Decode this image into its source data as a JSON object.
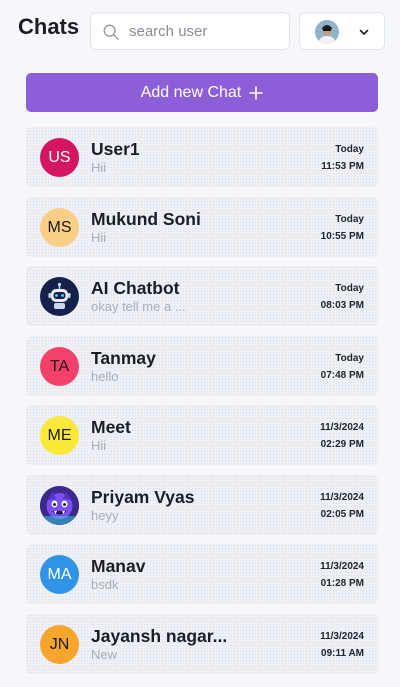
{
  "header": {
    "title": "Chats",
    "search_placeholder": "search user",
    "search_value": ""
  },
  "add_button": {
    "label": "Add new Chat"
  },
  "chats": [
    {
      "initials": "US",
      "name": "User1",
      "message": "Hii",
      "date": "Today",
      "time": "11:53 PM",
      "avatar_color": "#d4165e",
      "avatar_text": "light"
    },
    {
      "initials": "MS",
      "name": "Mukund Soni",
      "message": "Hii",
      "date": "Today",
      "time": "10:55 PM",
      "avatar_color": "#f9cf85",
      "avatar_text": "dark"
    },
    {
      "initials": "",
      "name": "AI Chatbot",
      "message": "okay tell me a ...",
      "date": "Today",
      "time": "08:03 PM",
      "avatar_color": "#13214b",
      "avatar_text": "light",
      "icon": "robot-icon"
    },
    {
      "initials": "TA",
      "name": "Tanmay",
      "message": "hello",
      "date": "Today",
      "time": "07:48 PM",
      "avatar_color": "#f4416c",
      "avatar_text": "dark"
    },
    {
      "initials": "ME",
      "name": "Meet",
      "message": "Hii",
      "date": "11/3/2024",
      "time": "02:29 PM",
      "avatar_color": "#fbe93a",
      "avatar_text": "dark"
    },
    {
      "initials": "",
      "name": "Priyam Vyas",
      "message": "heyy",
      "date": "11/3/2024",
      "time": "02:05 PM",
      "avatar_color": "#5b3fc7",
      "avatar_text": "light",
      "icon": "character-avatar-icon"
    },
    {
      "initials": "MA",
      "name": "Manav",
      "message": "bsdk",
      "date": "11/3/2024",
      "time": "01:28 PM",
      "avatar_color": "#2f93e6",
      "avatar_text": "light"
    },
    {
      "initials": "JN",
      "name": "Jayansh nagar...",
      "message": "New",
      "date": "11/3/2024",
      "time": "09:11 AM",
      "avatar_color": "#f7a52d",
      "avatar_text": "dark"
    }
  ],
  "colors": {
    "accent": "#8c5fd8",
    "background": "#f6f7fb",
    "message_text": "#a9adbc"
  }
}
